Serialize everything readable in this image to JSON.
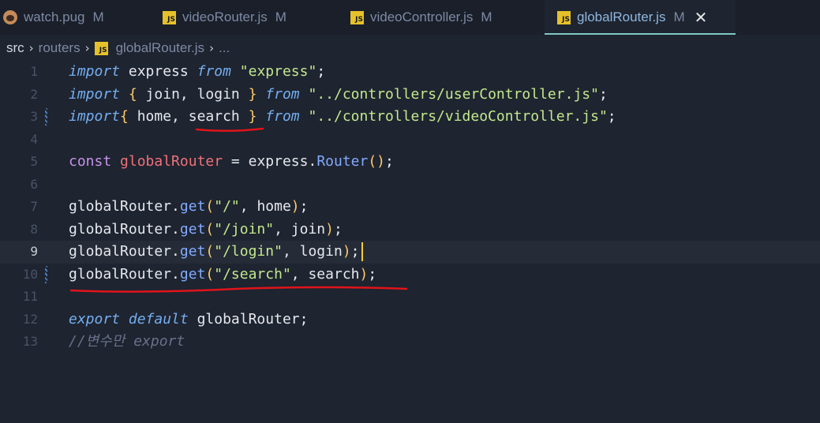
{
  "tabs": [
    {
      "name": "watch.pug",
      "modified": "M",
      "icon": "pug-icon"
    },
    {
      "name": "videoRouter.js",
      "modified": "M",
      "icon": "js-icon"
    },
    {
      "name": "videoController.js",
      "modified": "M",
      "icon": "js-icon"
    },
    {
      "name": "globalRouter.js",
      "modified": "M",
      "icon": "js-icon",
      "active": true
    }
  ],
  "close_glyph": "✕",
  "js_icon_text": "JS",
  "breadcrumb": {
    "root": "src",
    "folder": "routers",
    "file": "globalRouter.js",
    "ellipsis": "...",
    "separator": "›"
  },
  "editor": {
    "current_line": 9,
    "lines": [
      {
        "n": "1",
        "t": [
          [
            "kw",
            "import"
          ],
          [
            "ident",
            " express "
          ],
          [
            "kw",
            "from"
          ],
          [
            "ident",
            " "
          ],
          [
            "str",
            "\"express\""
          ],
          [
            "punc",
            ";"
          ]
        ]
      },
      {
        "n": "2",
        "t": [
          [
            "kw",
            "import"
          ],
          [
            "ident",
            " "
          ],
          [
            "brace",
            "{"
          ],
          [
            "ident",
            " join, login "
          ],
          [
            "brace",
            "}"
          ],
          [
            "ident",
            " "
          ],
          [
            "kw",
            "from"
          ],
          [
            "ident",
            " "
          ],
          [
            "str",
            "\"../controllers/userController.js\""
          ],
          [
            "punc",
            ";"
          ]
        ]
      },
      {
        "n": "3",
        "t": [
          [
            "kw",
            "import"
          ],
          [
            "brace",
            "{"
          ],
          [
            "ident",
            " home, search "
          ],
          [
            "brace",
            "}"
          ],
          [
            "ident",
            " "
          ],
          [
            "kw",
            "from"
          ],
          [
            "ident",
            " "
          ],
          [
            "str",
            "\"../controllers/videoController.js\""
          ],
          [
            "punc",
            ";"
          ]
        ]
      },
      {
        "n": "4",
        "t": []
      },
      {
        "n": "5",
        "t": [
          [
            "kw2",
            "const"
          ],
          [
            "ident",
            " "
          ],
          [
            "var",
            "globalRouter"
          ],
          [
            "ident",
            " "
          ],
          [
            "punc",
            "="
          ],
          [
            "ident",
            " express"
          ],
          [
            "punc",
            "."
          ],
          [
            "fn",
            "Router"
          ],
          [
            "brace",
            "()"
          ],
          [
            "punc",
            ";"
          ]
        ]
      },
      {
        "n": "6",
        "t": []
      },
      {
        "n": "7",
        "t": [
          [
            "ident",
            "globalRouter"
          ],
          [
            "punc",
            "."
          ],
          [
            "fn",
            "get"
          ],
          [
            "brace",
            "("
          ],
          [
            "str",
            "\"/\""
          ],
          [
            "ident",
            ", home"
          ],
          [
            "brace",
            ")"
          ],
          [
            "punc",
            ";"
          ]
        ]
      },
      {
        "n": "8",
        "t": [
          [
            "ident",
            "globalRouter"
          ],
          [
            "punc",
            "."
          ],
          [
            "fn",
            "get"
          ],
          [
            "brace",
            "("
          ],
          [
            "str",
            "\"/join\""
          ],
          [
            "ident",
            ", join"
          ],
          [
            "brace",
            ")"
          ],
          [
            "punc",
            ";"
          ]
        ]
      },
      {
        "n": "9",
        "t": [
          [
            "ident",
            "globalRouter"
          ],
          [
            "punc",
            "."
          ],
          [
            "fn",
            "get"
          ],
          [
            "brace",
            "("
          ],
          [
            "str",
            "\"/login\""
          ],
          [
            "ident",
            ", login"
          ],
          [
            "brace",
            ")"
          ],
          [
            "punc",
            ";"
          ]
        ]
      },
      {
        "n": "10",
        "t": [
          [
            "ident",
            "globalRouter"
          ],
          [
            "punc",
            "."
          ],
          [
            "fn",
            "get"
          ],
          [
            "brace",
            "("
          ],
          [
            "str",
            "\"/search\""
          ],
          [
            "ident",
            ", search"
          ],
          [
            "brace",
            ")"
          ],
          [
            "punc",
            ";"
          ]
        ]
      },
      {
        "n": "11",
        "t": []
      },
      {
        "n": "12",
        "t": [
          [
            "kw",
            "export"
          ],
          [
            "ident",
            " "
          ],
          [
            "kw",
            "default"
          ],
          [
            "ident",
            " globalRouter"
          ],
          [
            "punc",
            ";"
          ]
        ]
      },
      {
        "n": "13",
        "t": [
          [
            "cmt",
            "//변수만 export"
          ]
        ]
      }
    ],
    "gutter_marks": [
      3,
      10
    ]
  },
  "colors": {
    "annotation": "#e0141a",
    "accent": "#7fc8c3",
    "cursor": "#ffcc33"
  }
}
